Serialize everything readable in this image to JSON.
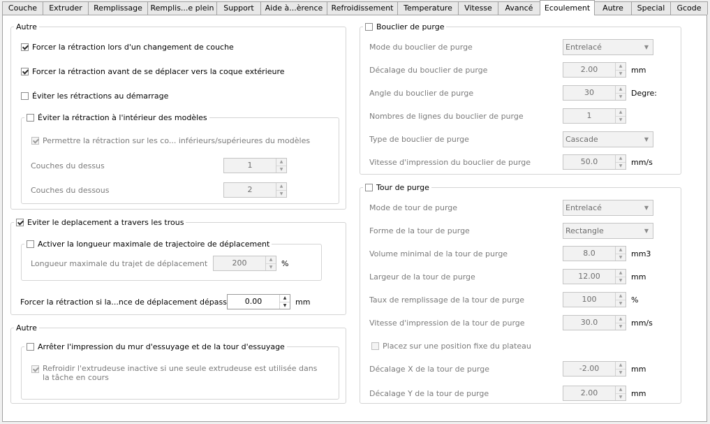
{
  "tabs": [
    {
      "label": "Couche"
    },
    {
      "label": "Extruder"
    },
    {
      "label": "Remplissage"
    },
    {
      "label": "Remplis...e plein"
    },
    {
      "label": "Support"
    },
    {
      "label": "Aide à...èrence"
    },
    {
      "label": "Refroidissement"
    },
    {
      "label": "Temperature"
    },
    {
      "label": "Vitesse"
    },
    {
      "label": "Avancé"
    },
    {
      "label": "Ecoulement"
    },
    {
      "label": "Autre"
    },
    {
      "label": "Special"
    },
    {
      "label": "Gcode"
    }
  ],
  "left": {
    "autre1": {
      "title": "Autre",
      "force_layer_change": "Forcer la rétraction lors d'un changement de couche",
      "force_outer_shell": "Forcer la rétraction avant de se déplacer vers la coque extérieure",
      "avoid_start": "Éviter les rétractions au démarrage",
      "avoid_inside": {
        "title": "Éviter la rétraction à l'intérieur des modèles",
        "allow_top_bottom": "Permettre la rétraction sur les co... inférieurs/supérieures du modèles",
        "top_layers_label": "Couches du dessus",
        "top_layers_value": "1",
        "bottom_layers_label": "Couches du dessous",
        "bottom_layers_value": "2"
      }
    },
    "avoid_holes": {
      "title": "Eviter le deplacement a travers les trous",
      "max_length": {
        "title": "Activer la longueur maximale de trajectoire de déplacement",
        "label": "Longueur maximale du trajet de déplacement",
        "value": "200",
        "unit": "%"
      },
      "force_distance_label": "Forcer la rétraction si la...nce de déplacement dépasse",
      "force_distance_value": "0.00",
      "force_distance_unit": "mm"
    },
    "autre2": {
      "title": "Autre",
      "stop_wipe": "Arrêter l'impression du mur d'essuyage et de la tour d'essuyage",
      "cool_inactive": "Refroidir l'extrudeuse inactive si une seule extrudeuse est utilisée dans la tâche en cours"
    }
  },
  "right": {
    "shield": {
      "title": "Bouclier de purge",
      "rows": [
        {
          "label": "Mode du bouclier de purge",
          "type": "combo",
          "value": "Entrelacé",
          "unit": ""
        },
        {
          "label": "Décalage du bouclier de purge",
          "type": "spin",
          "value": "2.00",
          "unit": "mm"
        },
        {
          "label": "Angle du bouclier de purge",
          "type": "spin",
          "value": "30",
          "unit": "Degre:"
        },
        {
          "label": "Nombres de lignes du bouclier de purge",
          "type": "spin",
          "value": "1",
          "unit": ""
        },
        {
          "label": "Type de bouclier de purge",
          "type": "combo",
          "value": "Cascade",
          "unit": ""
        },
        {
          "label": "Vitesse d'impression du bouclier de purge",
          "type": "spin",
          "value": "50.0",
          "unit": "mm/s"
        }
      ]
    },
    "tower": {
      "title": "Tour de purge",
      "rows": [
        {
          "label": "Mode de tour de purge",
          "type": "combo",
          "value": "Entrelacé",
          "unit": ""
        },
        {
          "label": "Forme de la tour de purge",
          "type": "combo",
          "value": "Rectangle",
          "unit": ""
        },
        {
          "label": "Volume minimal de la tour de purge",
          "type": "spin",
          "value": "8.0",
          "unit": "mm3"
        },
        {
          "label": "Largeur de la tour de purge",
          "type": "spin",
          "value": "12.00",
          "unit": "mm"
        },
        {
          "label": "Taux de remplissage de la tour de purge",
          "type": "spin",
          "value": "100",
          "unit": "%"
        },
        {
          "label": "Vitesse d'impression de la tour de purge",
          "type": "spin",
          "value": "30.0",
          "unit": "mm/s"
        }
      ],
      "fixed_position": "Placez sur une position fixe du plateau",
      "rows2": [
        {
          "label": "Décalage X de la tour de purge",
          "type": "spin",
          "value": "-2.00",
          "unit": "mm"
        },
        {
          "label": "Décalage Y de la tour de purge",
          "type": "spin",
          "value": "2.00",
          "unit": "mm"
        }
      ]
    }
  },
  "icons": {
    "spin_up": "▲",
    "spin_down": "▼",
    "combo_arrow": "▼"
  }
}
